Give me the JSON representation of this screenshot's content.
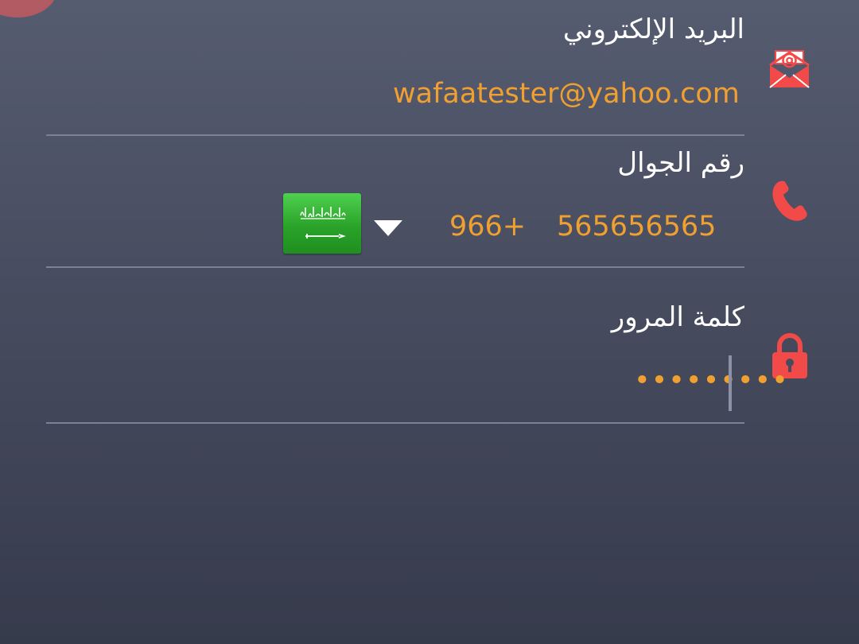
{
  "email": {
    "label": "البريد الإلكتروني",
    "value": "wafaatester@yahoo.com",
    "icon": "email-at-icon"
  },
  "phone": {
    "label": "رقم الجوال",
    "number": "565656565",
    "country_code": "966+",
    "country_flag": "saudi-arabia-flag",
    "icon": "phone-icon"
  },
  "password": {
    "label": "كلمة المرور",
    "masked_value": "•••••••••",
    "icon": "lock-icon"
  },
  "colors": {
    "accent": "#f0a030",
    "icon_red": "#f24a48",
    "background_top": "#565c70",
    "background_bottom": "#363b4c",
    "flag_green": "#2aa32a"
  }
}
